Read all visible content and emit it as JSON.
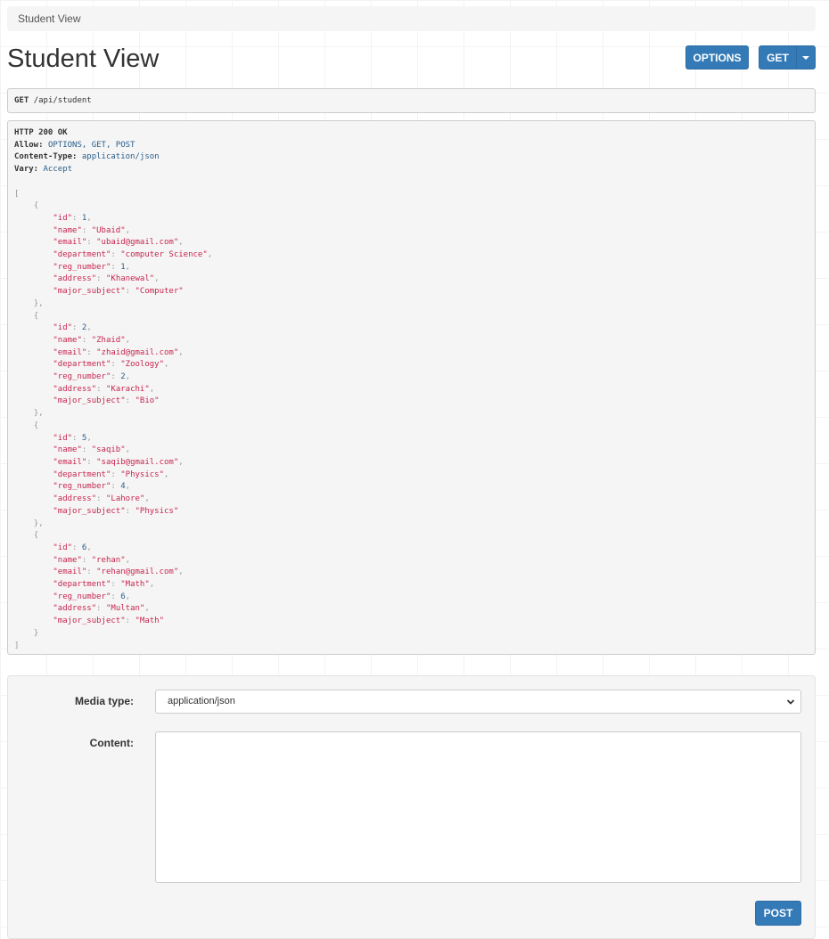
{
  "breadcrumb": {
    "label": "Student View"
  },
  "page": {
    "title": "Student View"
  },
  "toolbar": {
    "options_label": "OPTIONS",
    "get_label": "GET"
  },
  "request": {
    "method": "GET",
    "path": "/api/student"
  },
  "response": {
    "status": "HTTP 200 OK",
    "headers": [
      {
        "name": "Allow",
        "value": "OPTIONS, GET, POST"
      },
      {
        "name": "Content-Type",
        "value": "application/json"
      },
      {
        "name": "Vary",
        "value": "Accept"
      }
    ],
    "body": [
      {
        "id": 1,
        "name": "Ubaid",
        "email": "ubaid@gmail.com",
        "department": "computer Science",
        "reg_number": 1,
        "address": "Khanewal",
        "major_subject": "Computer"
      },
      {
        "id": 2,
        "name": "Zhaid",
        "email": "zhaid@gmail.com",
        "department": "Zoology",
        "reg_number": 2,
        "address": "Karachi",
        "major_subject": "Bio"
      },
      {
        "id": 5,
        "name": "saqib",
        "email": "saqib@gmail.com",
        "department": "Physics",
        "reg_number": 4,
        "address": "Lahore",
        "major_subject": "Physics"
      },
      {
        "id": 6,
        "name": "rehan",
        "email": "rehan@gmail.com",
        "department": "Math",
        "reg_number": 6,
        "address": "Multan",
        "major_subject": "Math"
      }
    ]
  },
  "form": {
    "media_type_label": "Media type:",
    "media_type_value": "application/json",
    "content_label": "Content:",
    "content_value": "",
    "post_label": "POST"
  },
  "colors": {
    "primary": "#337ab7",
    "string": "#c7254e",
    "number": "#2a5d8a",
    "panel": "#f5f5f5"
  }
}
